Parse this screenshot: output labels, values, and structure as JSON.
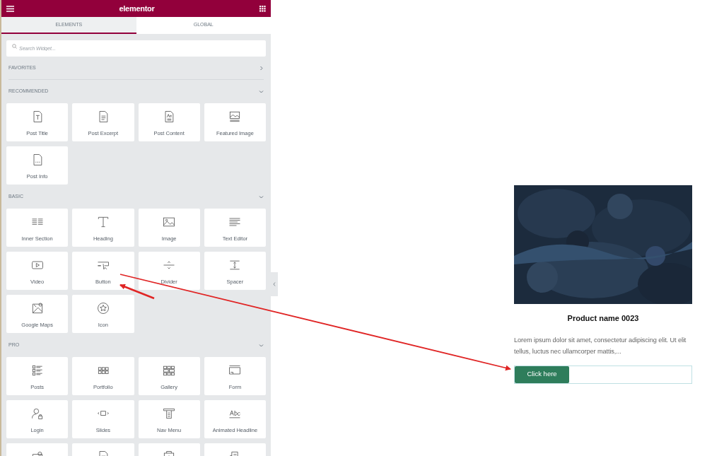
{
  "header": {
    "title": "elementor"
  },
  "tabs": [
    {
      "label": "ELEMENTS",
      "selected": true
    },
    {
      "label": "GLOBAL",
      "selected": false
    }
  ],
  "search": {
    "placeholder": "Search Widget..."
  },
  "sections": [
    {
      "title": "FAVORITES",
      "expanded": false
    },
    {
      "title": "RECOMMENDED",
      "expanded": true,
      "widgets": [
        {
          "label": "Post Title"
        },
        {
          "label": "Post Excerpt"
        },
        {
          "label": "Post Content"
        },
        {
          "label": "Featured Image"
        },
        {
          "label": "Post Info"
        }
      ]
    },
    {
      "title": "BASIC",
      "expanded": true,
      "widgets": [
        {
          "label": "Inner Section"
        },
        {
          "label": "Heading"
        },
        {
          "label": "Image"
        },
        {
          "label": "Text Editor"
        },
        {
          "label": "Video"
        },
        {
          "label": "Button"
        },
        {
          "label": "Divider"
        },
        {
          "label": "Spacer"
        },
        {
          "label": "Google Maps"
        },
        {
          "label": "Icon"
        }
      ]
    },
    {
      "title": "PRO",
      "expanded": true,
      "widgets": [
        {
          "kind": "labeled",
          "label": "Posts"
        },
        {
          "kind": "labeled",
          "label": "Portfolio"
        },
        {
          "kind": "labeled",
          "label": "Gallery"
        },
        {
          "kind": "labeled",
          "label": "Form"
        },
        {
          "kind": "labeled",
          "label": "Login"
        },
        {
          "kind": "labeled",
          "label": "Slides"
        },
        {
          "kind": "labeled",
          "label": "Nav Menu"
        },
        {
          "kind": "labeled",
          "label": "Animated Headline"
        },
        {
          "kind": "cut"
        },
        {
          "kind": "cut"
        },
        {
          "kind": "cut"
        },
        {
          "kind": "cut"
        }
      ]
    }
  ],
  "product": {
    "title": "Product name 0023",
    "description": "Lorem ipsum dolor sit amet, consectetur adipiscing elit. Ut elit tellus, luctus nec ullamcorper mattis,...",
    "button": "Click here"
  }
}
